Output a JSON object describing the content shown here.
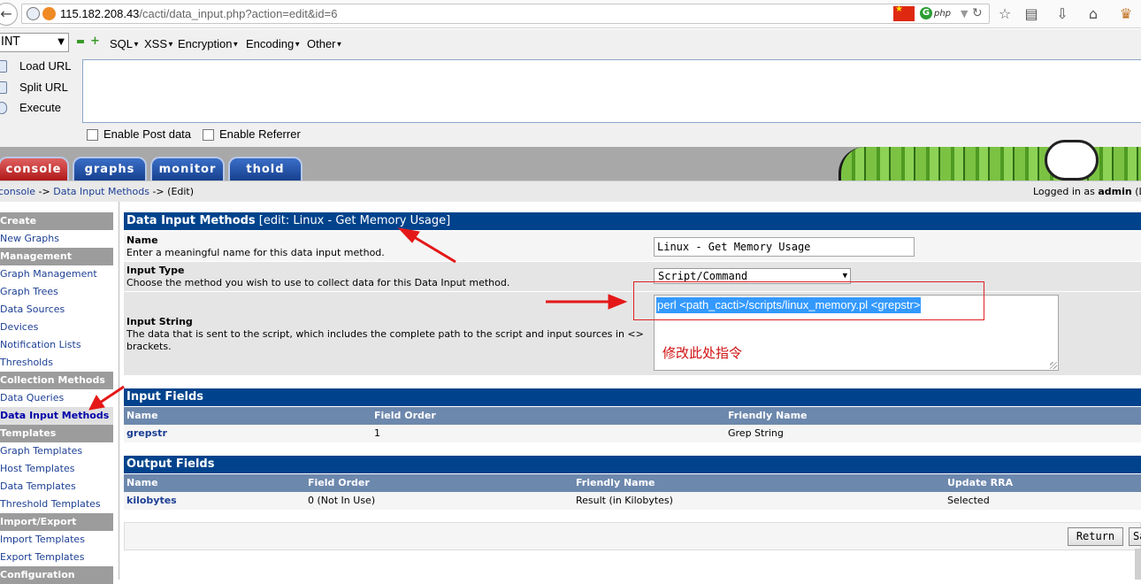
{
  "browser": {
    "url_host": "115.182.208.43",
    "url_path": "/cacti/data_input.php?action=edit&id=6"
  },
  "hackbar": {
    "select_value": "INT",
    "menus": [
      "SQL",
      "XSS",
      "Encryption",
      "Encoding",
      "Other"
    ],
    "load_url": "Load URL",
    "split_url": "Split URL",
    "execute": "Execute",
    "enable_post": "Enable Post data",
    "enable_referrer": "Enable Referrer"
  },
  "tabs": [
    "console",
    "graphs",
    "monitor",
    "thold"
  ],
  "breadcrumb": {
    "console": "console",
    "sep1": " -> ",
    "data_input_methods": "Data Input Methods",
    "sep2": " -> (Edit)",
    "logged_in_prefix": "Logged in as ",
    "user": "admin",
    "trailing": " (L"
  },
  "sidebar": {
    "create": "Create",
    "new_graphs": "New Graphs",
    "management": "Management",
    "graph_management": "Graph Management",
    "graph_trees": "Graph Trees",
    "data_sources": "Data Sources",
    "devices": "Devices",
    "notification_lists": "Notification Lists",
    "thresholds": "Thresholds",
    "collection_methods": "Collection Methods",
    "data_queries": "Data Queries",
    "data_input_methods": "Data Input Methods",
    "templates": "Templates",
    "graph_templates": "Graph Templates",
    "host_templates": "Host Templates",
    "data_templates": "Data Templates",
    "threshold_templates": "Threshold Templates",
    "import_export": "Import/Export",
    "import_templates": "Import Templates",
    "export_templates": "Export Templates",
    "configuration": "Configuration"
  },
  "form": {
    "header_title": "Data Input Methods",
    "header_sub": " [edit: Linux - Get Memory Usage]",
    "name_label": "Name",
    "name_desc": "Enter a meaningful name for this data input method.",
    "name_value": "Linux - Get Memory Usage",
    "type_label": "Input Type",
    "type_desc": "Choose the method you wish to use to collect data for this Data Input method.",
    "type_value": "Script/Command",
    "string_label": "Input String",
    "string_desc": "The data that is sent to the script, which includes the complete path to the script and input sources in <> brackets.",
    "string_value": "perl <path_cacti>/scripts/linux_memory.pl <grepstr>",
    "annotation": "修改此处指令"
  },
  "input_fields": {
    "title": "Input Fields",
    "columns": [
      "Name",
      "Field Order",
      "Friendly Name"
    ],
    "rows": [
      [
        "grepstr",
        "1",
        "Grep String"
      ]
    ]
  },
  "output_fields": {
    "title": "Output Fields",
    "columns": [
      "Name",
      "Field Order",
      "Friendly Name",
      "Update RRA"
    ],
    "rows": [
      [
        "kilobytes",
        "0 (Not In Use)",
        "Result (in Kilobytes)",
        "Selected"
      ]
    ]
  },
  "buttons": {
    "return": "Return",
    "save": "Save"
  },
  "colors": {
    "header_blue": "#00438c",
    "column_header": "#6d88ad",
    "annotation_red": "#e02020"
  }
}
